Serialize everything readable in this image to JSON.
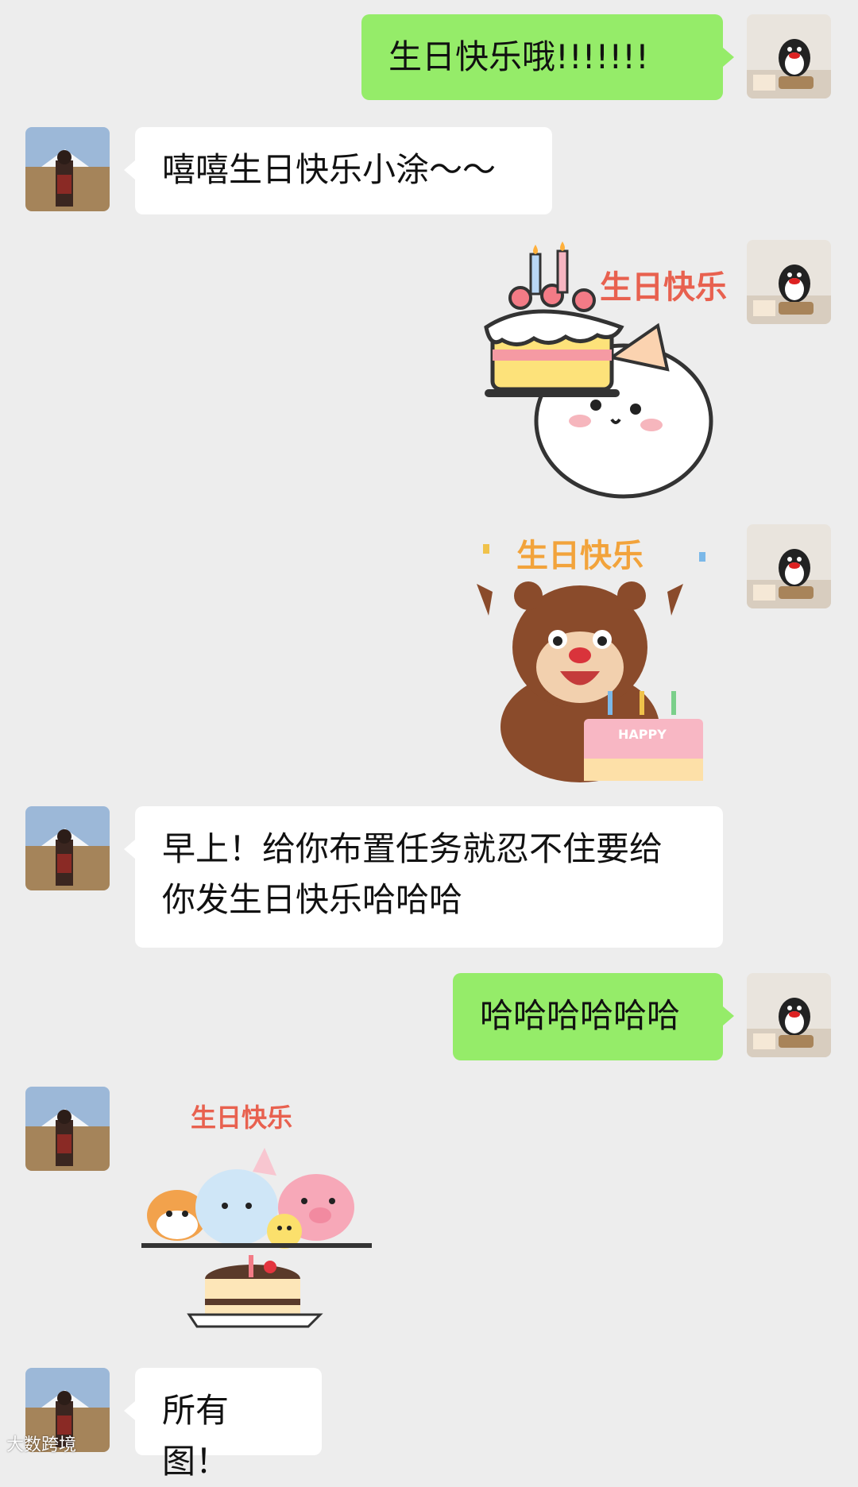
{
  "messages": [
    {
      "sender": "me",
      "type": "text",
      "text": "生日快乐哦!!!!!!!"
    },
    {
      "sender": "them",
      "type": "text",
      "text": "嘻嘻生日快乐小涂～～"
    },
    {
      "sender": "me",
      "type": "sticker",
      "sticker": "cake-mochi-sticker",
      "caption": "生日快乐"
    },
    {
      "sender": "me",
      "type": "sticker",
      "sticker": "bear-cake-sticker",
      "caption": "生日快乐",
      "cake_text": "HAPPY"
    },
    {
      "sender": "them",
      "type": "text",
      "text_line1": "早上！给你布置任务就忍不住要给",
      "text_line2": "你发生日快乐哈哈哈"
    },
    {
      "sender": "me",
      "type": "text",
      "text": "哈哈哈哈哈哈"
    },
    {
      "sender": "them",
      "type": "sticker",
      "sticker": "animals-cake-sticker",
      "caption": "生日快乐"
    },
    {
      "sender": "them",
      "type": "text",
      "text": "所有图！"
    }
  ],
  "watermark": "大数跨境",
  "colors": {
    "background": "#ededed",
    "me_bubble": "#95ec69",
    "them_bubble": "#ffffff"
  }
}
